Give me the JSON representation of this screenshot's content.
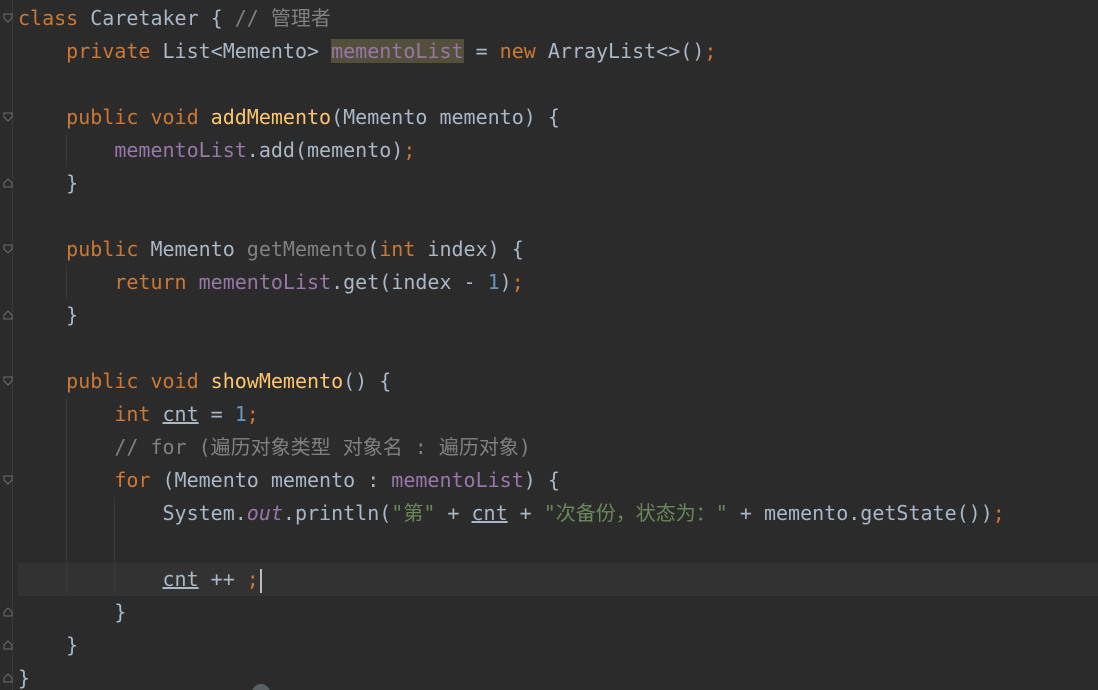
{
  "editor": {
    "lines": [
      {
        "tokens": [
          {
            "t": "class ",
            "c": "kw"
          },
          {
            "t": "Caretaker { ",
            "c": ""
          },
          {
            "t": "// 管理者",
            "c": "cm"
          }
        ]
      },
      {
        "tokens": [
          {
            "t": "    private ",
            "c": "kw"
          },
          {
            "t": "List<Memento> ",
            "c": ""
          },
          {
            "t": "mementoList",
            "c": "field highlight"
          },
          {
            "t": " = ",
            "c": ""
          },
          {
            "t": "new ",
            "c": "kw"
          },
          {
            "t": "ArrayList<>()",
            "c": ""
          },
          {
            "t": ";",
            "c": "kw"
          }
        ]
      },
      {
        "tokens": [
          {
            "t": "",
            "c": ""
          }
        ]
      },
      {
        "tokens": [
          {
            "t": "    public void ",
            "c": "kw"
          },
          {
            "t": "addMemento",
            "c": "fn"
          },
          {
            "t": "(Memento memento) {",
            "c": ""
          }
        ]
      },
      {
        "tokens": [
          {
            "t": "        ",
            "c": ""
          },
          {
            "t": "mementoList",
            "c": "field"
          },
          {
            "t": ".add(memento)",
            "c": ""
          },
          {
            "t": ";",
            "c": "kw"
          }
        ]
      },
      {
        "tokens": [
          {
            "t": "    }",
            "c": ""
          }
        ]
      },
      {
        "tokens": [
          {
            "t": "",
            "c": ""
          }
        ]
      },
      {
        "tokens": [
          {
            "t": "    public ",
            "c": "kw"
          },
          {
            "t": "Memento ",
            "c": ""
          },
          {
            "t": "getMemento",
            "c": "gray-fn"
          },
          {
            "t": "(",
            "c": ""
          },
          {
            "t": "int ",
            "c": "kw"
          },
          {
            "t": "index) {",
            "c": ""
          }
        ]
      },
      {
        "tokens": [
          {
            "t": "        return ",
            "c": "kw"
          },
          {
            "t": "mementoList",
            "c": "field"
          },
          {
            "t": ".get(index - ",
            "c": ""
          },
          {
            "t": "1",
            "c": "num"
          },
          {
            "t": ")",
            "c": ""
          },
          {
            "t": ";",
            "c": "kw"
          }
        ]
      },
      {
        "tokens": [
          {
            "t": "    }",
            "c": ""
          }
        ]
      },
      {
        "tokens": [
          {
            "t": "",
            "c": ""
          }
        ]
      },
      {
        "tokens": [
          {
            "t": "    public void ",
            "c": "kw"
          },
          {
            "t": "showMemento",
            "c": "fn"
          },
          {
            "t": "() {",
            "c": ""
          }
        ]
      },
      {
        "tokens": [
          {
            "t": "        int ",
            "c": "kw"
          },
          {
            "t": "cnt",
            "c": "underline"
          },
          {
            "t": " = ",
            "c": ""
          },
          {
            "t": "1",
            "c": "num"
          },
          {
            "t": ";",
            "c": "kw"
          }
        ]
      },
      {
        "tokens": [
          {
            "t": "        // for (遍历对象类型 对象名 : 遍历对象)",
            "c": "cm"
          }
        ]
      },
      {
        "tokens": [
          {
            "t": "        for ",
            "c": "kw"
          },
          {
            "t": "(Memento memento : ",
            "c": ""
          },
          {
            "t": "mementoList",
            "c": "field"
          },
          {
            "t": ") {",
            "c": ""
          }
        ]
      },
      {
        "tokens": [
          {
            "t": "            System.",
            "c": ""
          },
          {
            "t": "out",
            "c": "static-field"
          },
          {
            "t": ".println(",
            "c": ""
          },
          {
            "t": "\"第\"",
            "c": "str"
          },
          {
            "t": " + ",
            "c": ""
          },
          {
            "t": "cnt",
            "c": "underline"
          },
          {
            "t": " + ",
            "c": ""
          },
          {
            "t": "\"次备份，状态为：\"",
            "c": "str"
          },
          {
            "t": " + memento.getState())",
            "c": ""
          },
          {
            "t": ";",
            "c": "kw"
          }
        ]
      },
      {
        "tokens": [
          {
            "t": "",
            "c": ""
          }
        ]
      },
      {
        "tokens": [
          {
            "t": "            ",
            "c": ""
          },
          {
            "t": "cnt",
            "c": "underline"
          },
          {
            "t": " ++ ",
            "c": ""
          },
          {
            "t": ";",
            "c": "kw"
          }
        ],
        "caret": true
      },
      {
        "tokens": [
          {
            "t": "        }",
            "c": ""
          }
        ]
      },
      {
        "tokens": [
          {
            "t": "    }",
            "c": ""
          }
        ]
      },
      {
        "tokens": [
          {
            "t": "}",
            "c": ""
          }
        ]
      }
    ]
  }
}
